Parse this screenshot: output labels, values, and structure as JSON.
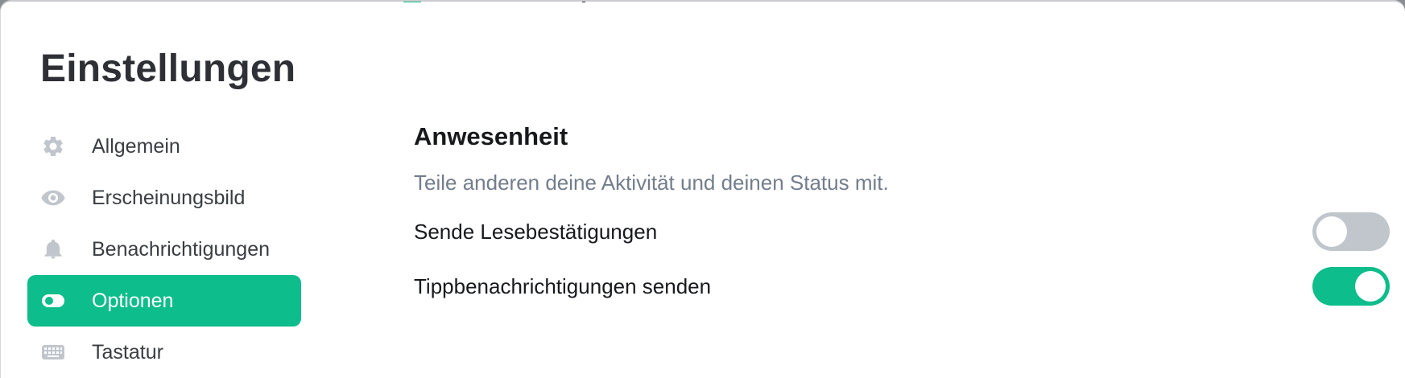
{
  "dialog": {
    "title": "Einstellungen"
  },
  "sidebar": {
    "items": [
      {
        "label": "Allgemein",
        "icon": "gear-icon",
        "active": false
      },
      {
        "label": "Erscheinungsbild",
        "icon": "eye-icon",
        "active": false
      },
      {
        "label": "Benachrichtigungen",
        "icon": "bell-icon",
        "active": false
      },
      {
        "label": "Optionen",
        "icon": "toggle-icon",
        "active": true
      },
      {
        "label": "Tastatur",
        "icon": "keyboard-icon",
        "active": false
      }
    ]
  },
  "presence": {
    "title": "Anwesenheit",
    "description": "Teile anderen deine Aktivität und deinen Status mit.",
    "settings": [
      {
        "label": "Sende Lesebestätigungen",
        "enabled": false
      },
      {
        "label": "Tippbenachrichtigungen senden",
        "enabled": true
      }
    ]
  },
  "colors": {
    "accent": "#0dbd8b",
    "toggle_off": "#c1c6cd",
    "icon_gray": "#c1c6cd",
    "text_primary": "#17191c",
    "text_secondary": "#737d8c"
  }
}
